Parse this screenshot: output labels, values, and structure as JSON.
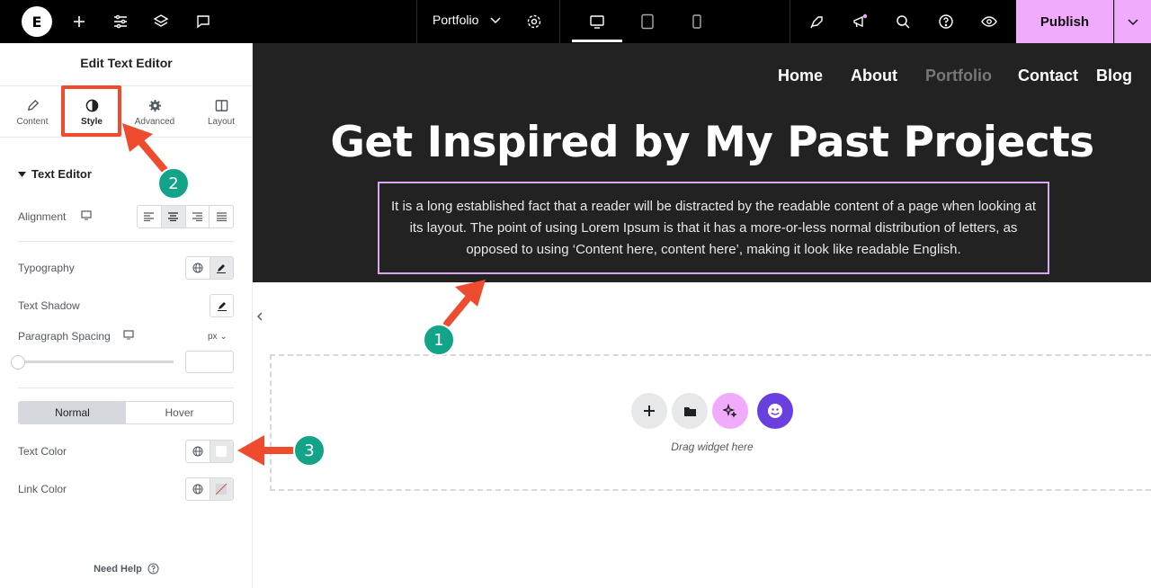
{
  "topbar": {
    "logo_text": "E",
    "page_selector": "Portfolio",
    "publish_label": "Publish"
  },
  "panel": {
    "title": "Edit Text Editor",
    "tabs": [
      {
        "label": "Content",
        "icon": "pencil-icon"
      },
      {
        "label": "Style",
        "icon": "contrast-icon",
        "active": true
      },
      {
        "label": "Advanced",
        "icon": "gear-icon"
      },
      {
        "label": "Layout",
        "icon": "columns-icon"
      }
    ],
    "section": "Text Editor",
    "alignment_label": "Alignment",
    "typography_label": "Typography",
    "text_shadow_label": "Text Shadow",
    "paragraph_spacing_label": "Paragraph Spacing",
    "paragraph_spacing_unit": "px",
    "state_tabs": [
      "Normal",
      "Hover"
    ],
    "text_color_label": "Text Color",
    "link_color_label": "Link Color",
    "need_help": "Need Help"
  },
  "site": {
    "nav": [
      "Home",
      "About",
      "Portfolio",
      "Contact",
      "Blog"
    ],
    "hero_title": "Get Inspired by My Past Projects",
    "hero_text": "It is a long established fact that a reader will be distracted by the readable content of a page when looking at its layout. The point of using Lorem Ipsum is that it has a more-or-less normal distribution of letters, as opposed to using ‘Content here, content here’, making it look like readable English."
  },
  "dropzone": {
    "label": "Drag widget here"
  },
  "annotations": {
    "badge_1": "1",
    "badge_2": "2",
    "badge_3": "3"
  },
  "colors": {
    "accent_pink": "#f0abfc",
    "annotation_red": "#ef4c2f",
    "badge_green": "#12a389",
    "hero_bg": "#222222"
  }
}
